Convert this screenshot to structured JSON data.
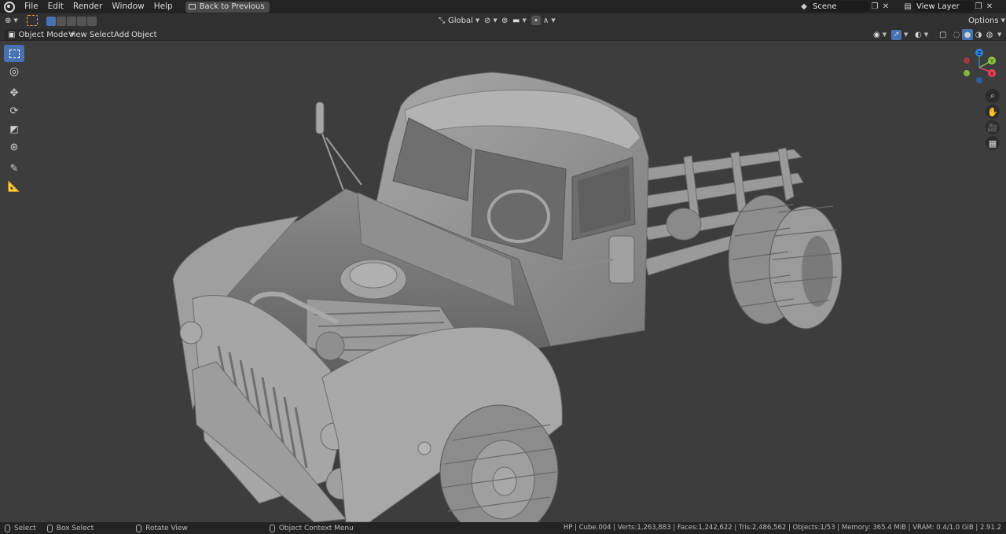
{
  "menu": {
    "items": [
      "File",
      "Edit",
      "Render",
      "Window",
      "Help"
    ],
    "back_button": "Back to Previous"
  },
  "scene": {
    "value": "Scene"
  },
  "view_layer": {
    "value": "View Layer"
  },
  "header": {
    "transform_orientation": "Global",
    "options_label": "Options"
  },
  "header2": {
    "mode": "Object Mode",
    "menus": [
      "View",
      "Select",
      "Add",
      "Object"
    ]
  },
  "gizmo": {
    "x": "X",
    "y": "Y",
    "z": "Z"
  },
  "status": {
    "select": "Select",
    "box_select": "Box Select",
    "rotate_view": "Rotate View",
    "context_menu": "Object Context Menu",
    "stats": "HP | Cube.004 | Verts:1,263,883 | Faces:1,242,622 | Tris:2,486,562 | Objects:1/53 | Memory: 365.4 MiB | VRAM: 0.4/1.0 GiB | 2.91.2"
  },
  "colors": {
    "accent": "#4772b3",
    "axis_x": "#e64459",
    "axis_y": "#8bc53f",
    "axis_z": "#2f85e0"
  }
}
